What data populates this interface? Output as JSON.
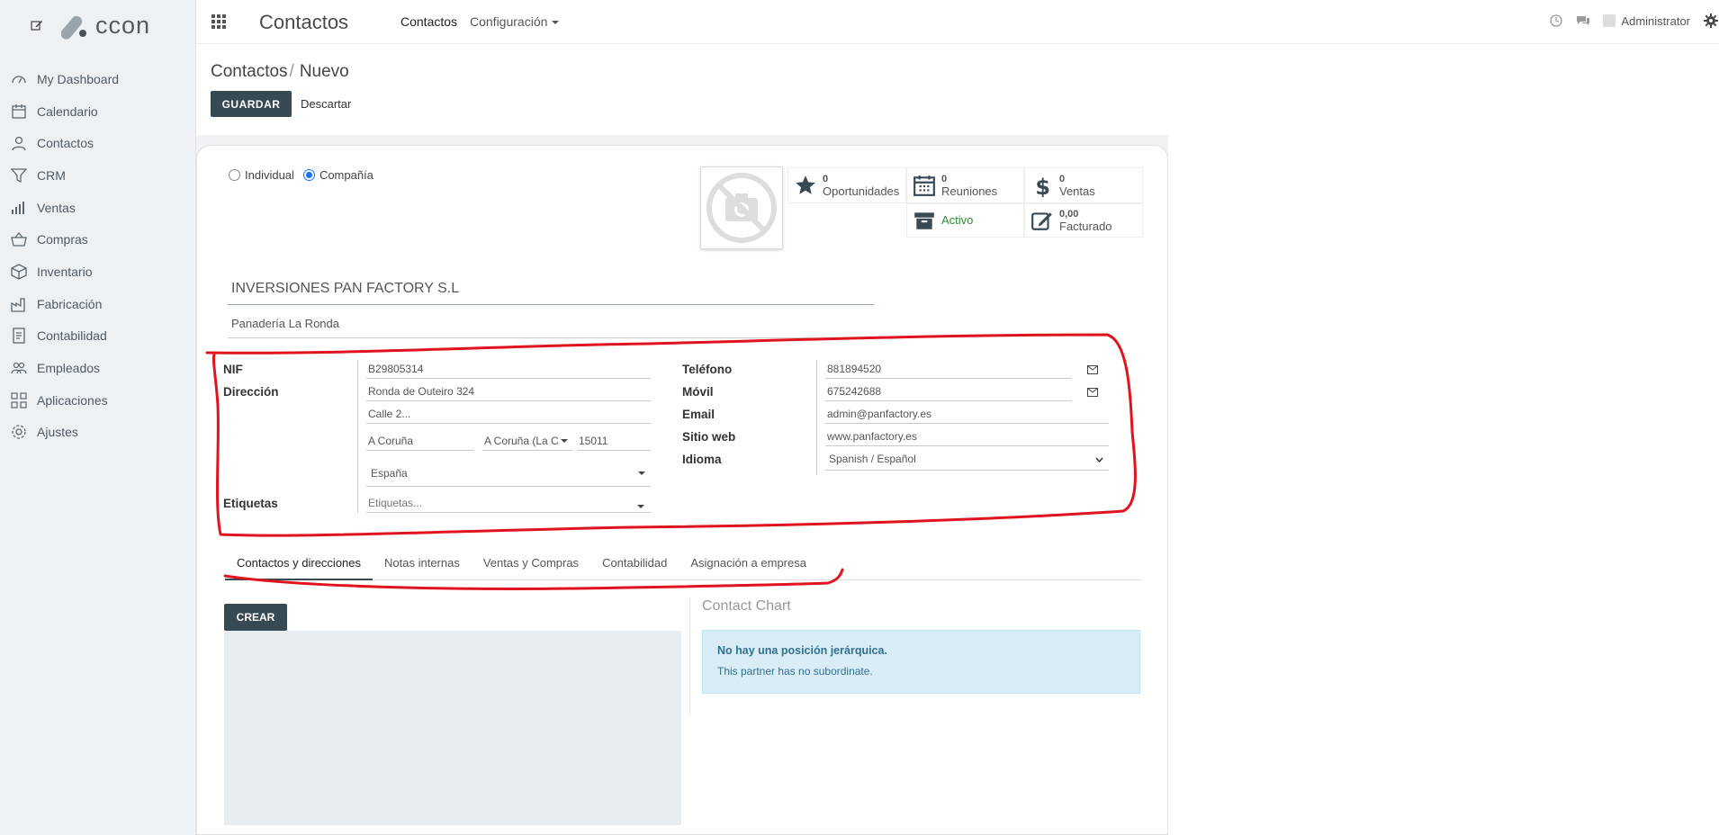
{
  "sidebar": {
    "logo_text": "ccon",
    "items": [
      {
        "label": "My Dashboard",
        "icon": "dashboard-icon"
      },
      {
        "label": "Calendario",
        "icon": "calendar-icon"
      },
      {
        "label": "Contactos",
        "icon": "user-icon"
      },
      {
        "label": "CRM",
        "icon": "filter-icon"
      },
      {
        "label": "Ventas",
        "icon": "bar-chart-icon"
      },
      {
        "label": "Compras",
        "icon": "basket-icon"
      },
      {
        "label": "Inventario",
        "icon": "box-icon"
      },
      {
        "label": "Fabricación",
        "icon": "factory-icon"
      },
      {
        "label": "Contabilidad",
        "icon": "ledger-icon"
      },
      {
        "label": "Empleados",
        "icon": "people-icon"
      },
      {
        "label": "Aplicaciones",
        "icon": "apps-icon"
      },
      {
        "label": "Ajustes",
        "icon": "gear-icon"
      }
    ]
  },
  "topbar": {
    "app_title": "Contactos",
    "menu_contactos": "Contactos",
    "menu_config": "Configuración",
    "user": "Administrator"
  },
  "control": {
    "breadcrumb_parent": "Contactos",
    "breadcrumb_sep": "/",
    "breadcrumb_current": "Nuevo",
    "save_label": "GUARDAR",
    "discard_label": "Descartar"
  },
  "form": {
    "type_individual": "Individual",
    "type_company": "Compañía",
    "company_name": "INVERSIONES PAN FACTORY S.L",
    "reference": "Panadería La Ronda",
    "smart_buttons": {
      "opportunities": {
        "count": "0",
        "label": "Oportunidades"
      },
      "meetings": {
        "count": "0",
        "label": "Reuniones"
      },
      "sales": {
        "count": "0",
        "label": "Ventas"
      },
      "active": {
        "label": "Activo"
      },
      "invoiced": {
        "count": "0,00",
        "label": "Facturado"
      }
    },
    "labels": {
      "nif": "NIF",
      "address": "Dirección",
      "tags": "Etiquetas",
      "phone": "Teléfono",
      "mobile": "Móvil",
      "email": "Email",
      "website": "Sitio web",
      "language": "Idioma"
    },
    "values": {
      "nif": "B29805314",
      "street": "Ronda de Outeiro 324",
      "street2": "Calle 2...",
      "city": "A Coruña",
      "state": "A Coruña (La C",
      "zip": "15011",
      "country": "España",
      "tags_placeholder": "Etiquetas...",
      "phone": "881894520",
      "mobile": "675242688",
      "email": "admin@panfactory.es",
      "website": "www.panfactory.es",
      "language": "Spanish / Español"
    }
  },
  "tabs": [
    {
      "label": "Contactos y direcciones",
      "active": true
    },
    {
      "label": "Notas internas"
    },
    {
      "label": "Ventas y Compras"
    },
    {
      "label": "Contabilidad"
    },
    {
      "label": "Asignación a empresa"
    }
  ],
  "contacts_tab": {
    "create_label": "CREAR",
    "chart_title": "Contact Chart",
    "alert_title": "No hay una posición jerárquica.",
    "alert_text": "This partner has no subordinate."
  },
  "colors": {
    "primary_button": "#374953",
    "sidebar_bg": "#eef1f3",
    "active_green": "#2e8b2e",
    "alert_bg": "#d9edf7",
    "annotation_red": "#e0141e"
  }
}
